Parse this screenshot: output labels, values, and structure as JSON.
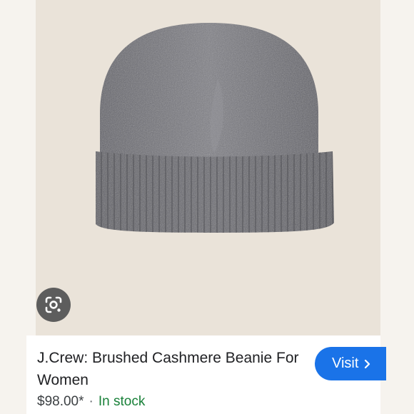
{
  "product": {
    "title": "J.Crew: Brushed Cashmere Beanie For Women",
    "price": "$98.00*",
    "separator": "·",
    "availability": "In stock",
    "availability_color": "#188038"
  },
  "actions": {
    "visit_label": "Visit",
    "visit_icon": "chevron-right-icon",
    "lens_icon": "google-lens-icon",
    "accent_color": "#1a73e8"
  }
}
